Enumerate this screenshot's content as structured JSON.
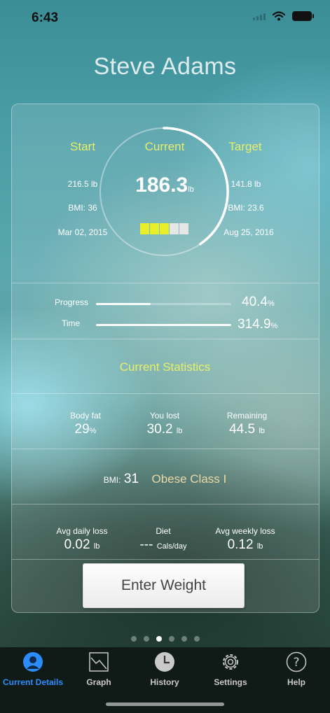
{
  "status_bar": {
    "time": "6:43",
    "icons": [
      "signal-icon",
      "wifi-icon",
      "battery-icon"
    ]
  },
  "user": {
    "name": "Steve Adams"
  },
  "summary": {
    "start": {
      "label": "Start",
      "weight": "216.5 lb",
      "bmi": "BMI: 36",
      "date": "Mar 02, 2015"
    },
    "current": {
      "label": "Current",
      "value": "186.3",
      "unit": "lb",
      "level_filled": 3,
      "level_total": 5,
      "progress_fraction": 0.404
    },
    "target": {
      "label": "Target",
      "weight": "141.8 lb",
      "bmi": "BMI: 23.6",
      "date": "Aug 25, 2016"
    }
  },
  "bars": {
    "progress": {
      "label": "Progress",
      "value": "40.4",
      "unit": "%",
      "fraction": 0.404
    },
    "time": {
      "label": "Time",
      "value": "314.9",
      "unit": "%",
      "fraction": 1.0
    }
  },
  "current_statistics": {
    "title": "Current Statistics",
    "body_fat": {
      "label": "Body fat",
      "value": "29",
      "unit": "%"
    },
    "you_lost": {
      "label": "You lost",
      "value": "30.2",
      "unit": "lb"
    },
    "remaining": {
      "label": "Remaining",
      "value": "44.5",
      "unit": "lb"
    },
    "bmi": {
      "label": "BMI:",
      "value": "31",
      "class": "Obese Class I"
    },
    "avg_daily_loss": {
      "label": "Avg daily loss",
      "value": "0.02",
      "unit": "lb"
    },
    "diet": {
      "label": "Diet",
      "value": "---",
      "unit": "Cals/day"
    },
    "avg_weekly_loss": {
      "label": "Avg weekly loss",
      "value": "0.12",
      "unit": "lb"
    }
  },
  "actions": {
    "enter_weight": "Enter Weight"
  },
  "page_indicator": {
    "count": 6,
    "active_index": 2
  },
  "tabs": [
    {
      "label": "Current Details",
      "icon": "person-icon",
      "active": true
    },
    {
      "label": "Graph",
      "icon": "graph-icon",
      "active": false
    },
    {
      "label": "History",
      "icon": "clock-icon",
      "active": false
    },
    {
      "label": "Settings",
      "icon": "gear-icon",
      "active": false
    },
    {
      "label": "Help",
      "icon": "help-icon",
      "active": false
    }
  ],
  "colors": {
    "accent_yellow": "#e8ef6a",
    "tab_active": "#2a8cff",
    "bmi_class": "#ead9a5",
    "level_filled": "#e8ef2a",
    "level_empty": "#e6e6e6"
  }
}
